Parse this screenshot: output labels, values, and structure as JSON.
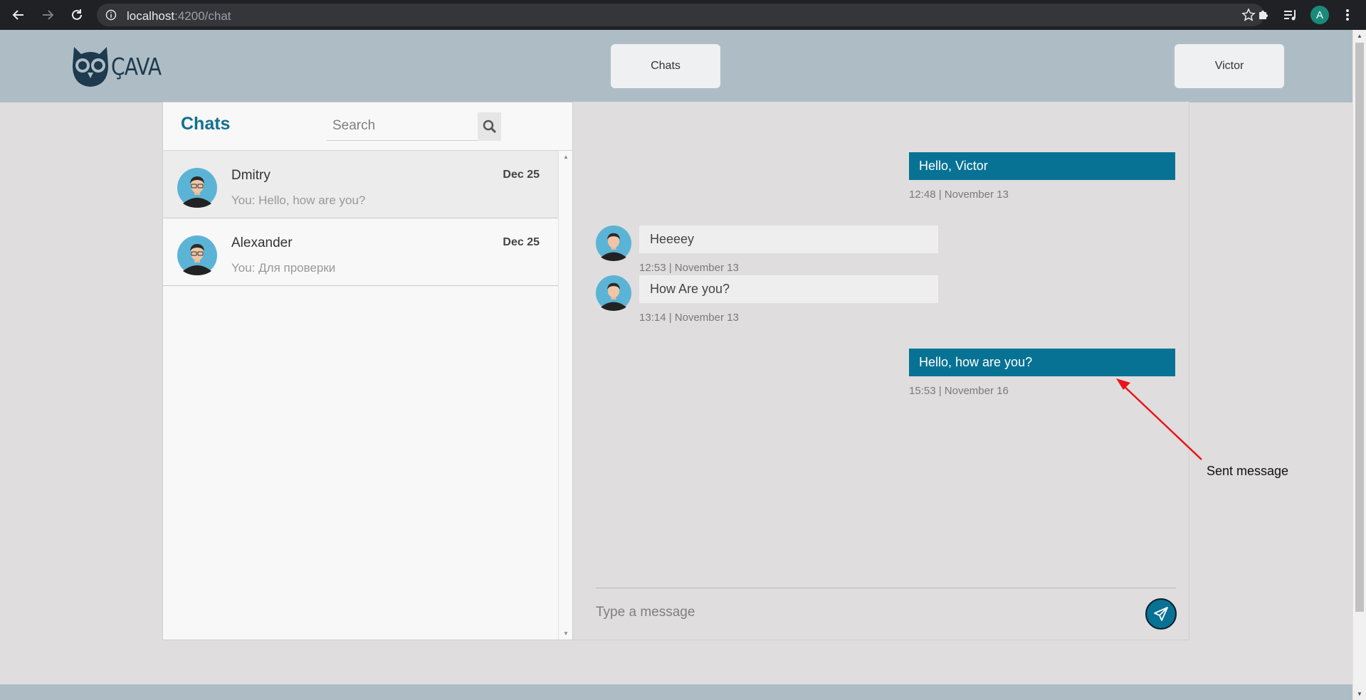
{
  "browser": {
    "url_host": "localhost",
    "url_rest": ":4200/chat",
    "profile_initial": "A"
  },
  "header": {
    "logo_text": "ÇAVA",
    "chats_button": "Chats",
    "user_button": "Victor"
  },
  "chat_list": {
    "title": "Chats",
    "search_placeholder": "Search",
    "items": [
      {
        "name": "Dmitry",
        "date": "Dec 25",
        "preview": "You: Hello, how are you?"
      },
      {
        "name": "Alexander",
        "date": "Dec 25",
        "preview": "You: Для проверки"
      }
    ]
  },
  "conversation": {
    "messages": [
      {
        "direction": "outgoing",
        "text": "Hello, Victor",
        "meta": "12:48 | November 13"
      },
      {
        "direction": "incoming",
        "text": "Heeeey",
        "meta": "12:53 | November 13"
      },
      {
        "direction": "incoming",
        "text": "How Are you?",
        "meta": "13:14 | November 13"
      },
      {
        "direction": "outgoing",
        "text": "Hello, how are you?",
        "meta": "15:53 | November 16"
      }
    ],
    "composer_placeholder": "Type a message"
  },
  "annotation": {
    "label": "Sent message",
    "color": "#e8141b"
  },
  "colors": {
    "accent": "#087294",
    "header_bg": "#aebdc5",
    "avatar_bg": "#5bb4d6"
  }
}
